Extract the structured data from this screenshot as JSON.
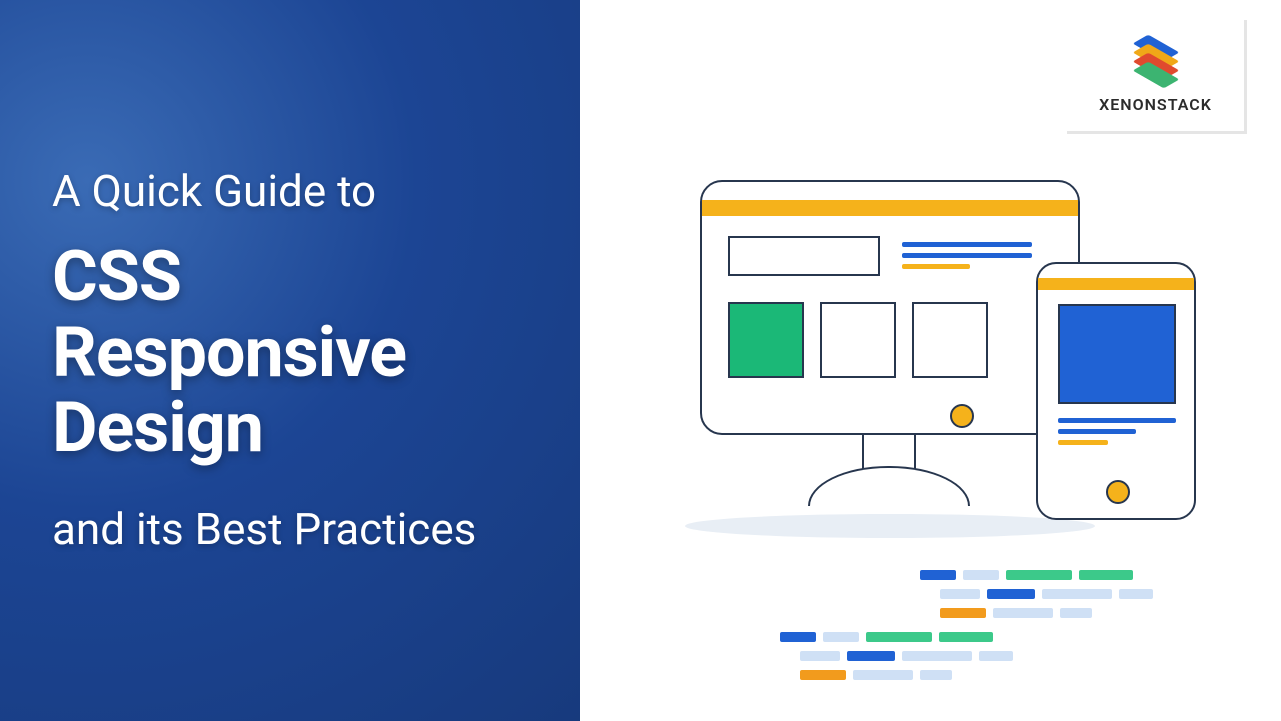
{
  "heading": {
    "pre": "A Quick Guide to",
    "main": "CSS Responsive Design",
    "post": "and its Best Practices"
  },
  "brand": {
    "name": "XENONSTACK"
  },
  "colors": {
    "primary_blue": "#1c4594",
    "accent_yellow": "#f5b21b",
    "accent_green": "#1bb877",
    "accent_orange": "#f29b1d",
    "bright_blue": "#2062d4"
  }
}
